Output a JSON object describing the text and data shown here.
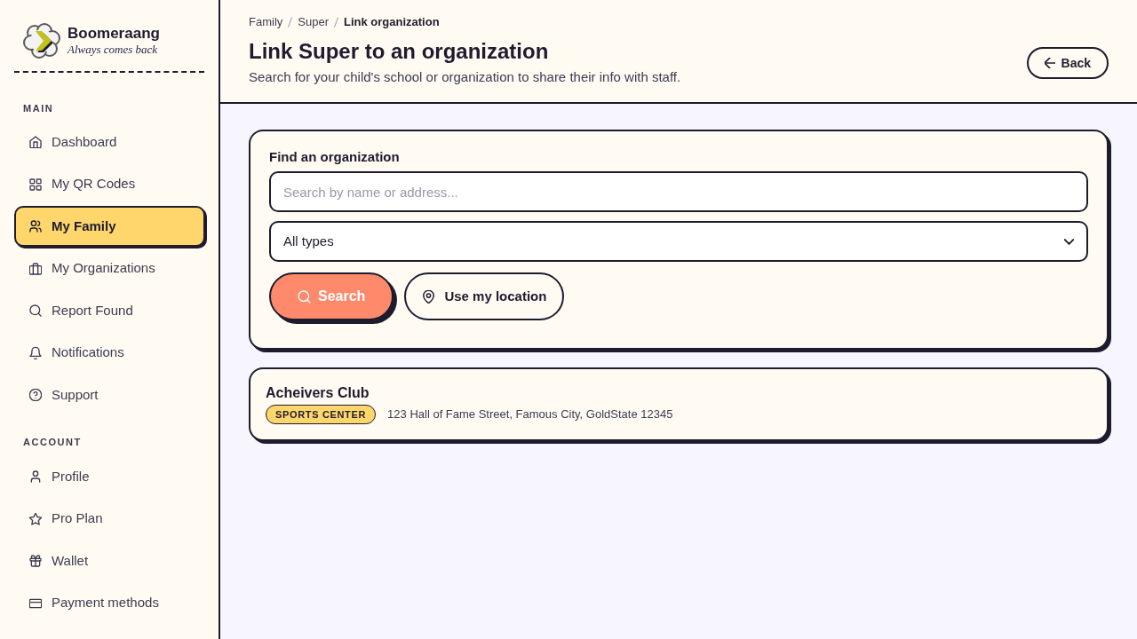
{
  "brand": {
    "name": "Boomeraang",
    "tagline": "Always comes back"
  },
  "sidebar": {
    "sections": [
      {
        "heading": "MAIN",
        "items": [
          {
            "label": "Dashboard",
            "selected": false
          },
          {
            "label": "My QR Codes",
            "selected": false
          },
          {
            "label": "My Family",
            "selected": true
          },
          {
            "label": "My Organizations",
            "selected": false
          },
          {
            "label": "Report Found",
            "selected": false
          },
          {
            "label": "Notifications",
            "selected": false
          },
          {
            "label": "Support",
            "selected": false
          }
        ]
      },
      {
        "heading": "ACCOUNT",
        "items": [
          {
            "label": "Profile",
            "selected": false
          },
          {
            "label": "Pro Plan",
            "selected": false
          },
          {
            "label": "Wallet",
            "selected": false
          },
          {
            "label": "Payment methods",
            "selected": false
          }
        ]
      }
    ]
  },
  "breadcrumb": [
    {
      "label": "Family",
      "current": false
    },
    {
      "label": "Super",
      "current": false
    },
    {
      "label": "Link organization",
      "current": true
    }
  ],
  "page": {
    "title": "Link Super to an organization",
    "subtitle": "Search for your child's school or organization to share their info with staff."
  },
  "back_button": {
    "label": "Back"
  },
  "search_card": {
    "heading": "Find an organization",
    "search_field": {
      "placeholder": "Search by name or address..."
    },
    "type_select": {
      "value": "All types"
    },
    "buttons": [
      {
        "label": "Search",
        "kind": "primary"
      },
      {
        "label": "Use my location",
        "kind": "secondary"
      }
    ]
  },
  "results": [
    {
      "name": "Acheivers Club",
      "type": "SPORTS CENTER",
      "address": "123 Hall of Fame Street, Famous City, GoldState 12345"
    }
  ]
}
